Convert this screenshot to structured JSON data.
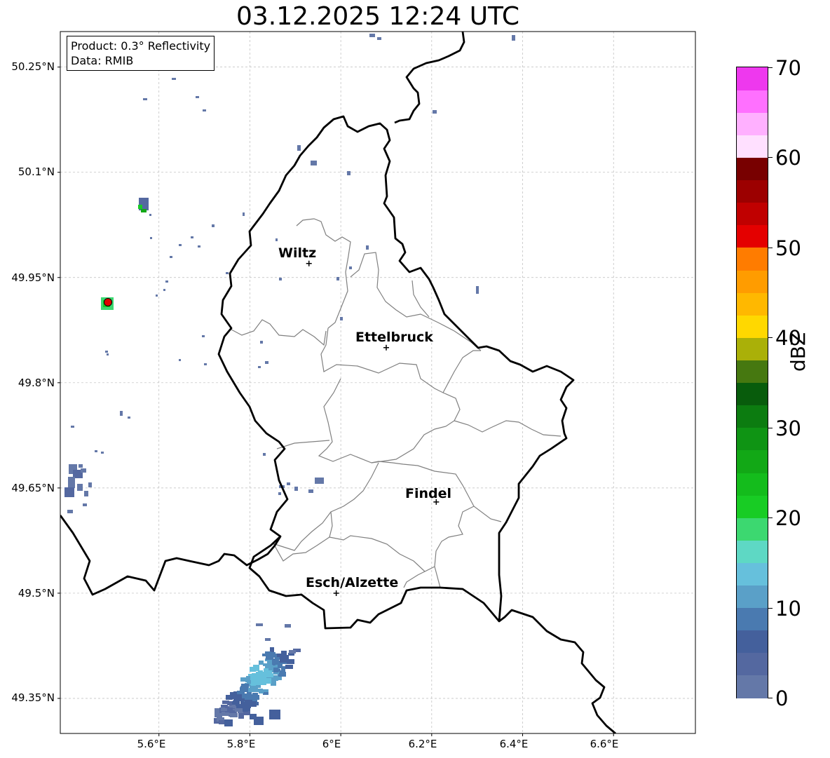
{
  "title": "03.12.2025 12:24 UTC",
  "info": {
    "product": "Product: 0.3° Reflectivity",
    "data": "Data: RMIB"
  },
  "axes": {
    "lat_ticks": [
      "50.25°N",
      "50.1°N",
      "49.95°N",
      "49.8°N",
      "49.65°N",
      "49.5°N",
      "49.35°N"
    ],
    "lon_ticks": [
      "5.6°E",
      "5.8°E",
      "6°E",
      "6.2°E",
      "6.4°E",
      "6.6°E"
    ]
  },
  "cities": [
    {
      "name": "Wiltz",
      "lon": 5.93,
      "lat": 49.97
    },
    {
      "name": "Ettelbruck",
      "lon": 6.1,
      "lat": 49.85
    },
    {
      "name": "Findel",
      "lon": 6.21,
      "lat": 49.63
    },
    {
      "name": "Esch/Alzette",
      "lon": 5.99,
      "lat": 49.5
    }
  ],
  "colorbar": {
    "label": "dBZ",
    "ticks": [
      "0",
      "10",
      "20",
      "30",
      "40",
      "50",
      "60",
      "70"
    ],
    "min": 0,
    "max": 70,
    "step": 2.5,
    "colors": [
      "#6478a8",
      "#5468a0",
      "#44609c",
      "#4a7ab0",
      "#5aa0c8",
      "#66c0dc",
      "#5ed8c4",
      "#3cd870",
      "#18cc24",
      "#14bc1c",
      "#12a816",
      "#0f9414",
      "#0c7c10",
      "#085c0c",
      "#467810",
      "#aab008",
      "#ffd800",
      "#ffb800",
      "#ff9c00",
      "#ff7c00",
      "#e40000",
      "#c00000",
      "#9c0000",
      "#780000",
      "#ffe0ff",
      "#ffb0ff",
      "#ff70ff",
      "#ee38ee"
    ]
  },
  "colors": {
    "border": "#000000",
    "canton": "#808080",
    "grid": "#bbbbbb",
    "echo": "#6478a8"
  }
}
